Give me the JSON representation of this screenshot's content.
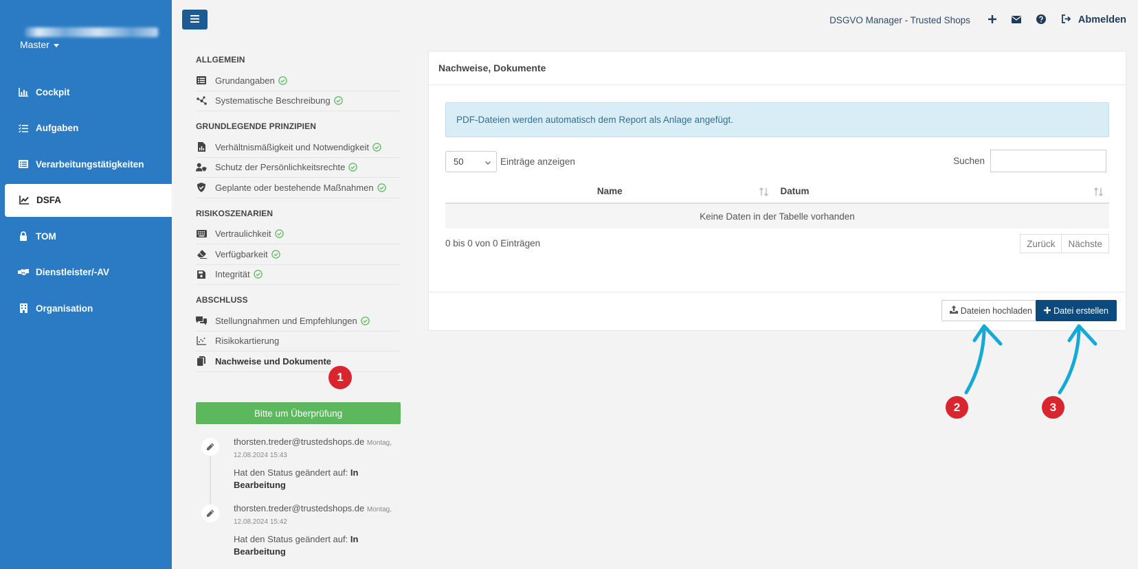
{
  "sidebar": {
    "user_email_blurred": "(blurred)",
    "workspace": "Master",
    "items": [
      {
        "label": "Cockpit",
        "icon": "chart-bar-icon"
      },
      {
        "label": "Aufgaben",
        "icon": "tasks-icon"
      },
      {
        "label": "Verarbeitungstätigkeiten",
        "icon": "list-icon"
      },
      {
        "label": "DSFA",
        "icon": "chart-line-icon",
        "active": true
      },
      {
        "label": "TOM",
        "icon": "lock-icon"
      },
      {
        "label": "Dienstleister/-AV",
        "icon": "handshake-icon"
      },
      {
        "label": "Organisation",
        "icon": "building-icon"
      }
    ]
  },
  "header": {
    "brand": "DSGVO Manager - Trusted Shops",
    "logout_label": "Abmelden"
  },
  "menu": {
    "sections": [
      {
        "title": "ALLGEMEIN",
        "items": [
          {
            "label": "Grundangaben",
            "icon": "list-icon",
            "done": true
          },
          {
            "label": "Systematische Beschreibung",
            "icon": "network-icon",
            "done": true
          }
        ]
      },
      {
        "title": "GRUNDLEGENDE PRINZIPIEN",
        "items": [
          {
            "label": "Verhältnismäßigkeit und Notwendigkeit",
            "icon": "file-chart-icon",
            "done": true
          },
          {
            "label": "Schutz der Persönlichkeitsrechte",
            "icon": "user-shield-icon",
            "done": true
          },
          {
            "label": "Geplante oder bestehende Maßnahmen",
            "icon": "shield-check-icon",
            "done": true
          }
        ]
      },
      {
        "title": "RISIKOSZENARIEN",
        "items": [
          {
            "label": "Vertraulichkeit",
            "icon": "keyboard-icon",
            "done": true
          },
          {
            "label": "Verfügbarkeit",
            "icon": "eraser-icon",
            "done": true
          },
          {
            "label": "Integrität",
            "icon": "save-icon",
            "done": true
          }
        ]
      },
      {
        "title": "ABSCHLUSS",
        "items": [
          {
            "label": "Stellungnahmen und Empfehlungen",
            "icon": "comments-icon",
            "done": true
          },
          {
            "label": "Risikokartierung",
            "icon": "scatter-chart-icon",
            "done": false
          },
          {
            "label": "Nachweise und Dokumente",
            "icon": "copy-icon",
            "done": false,
            "active": true
          }
        ]
      }
    ],
    "review_button": "Bitte um Überprüfung"
  },
  "timeline": [
    {
      "user": "thorsten.treder@trustedshops.de",
      "date_line1": "Montag,",
      "date_line2": "12.08.2024 15:43",
      "text": "Hat den Status geändert auf:",
      "status": "In Bearbeitung"
    },
    {
      "user": "thorsten.treder@trustedshops.de",
      "date_line1": "Montag,",
      "date_line2": "12.08.2024 15:42",
      "text": "Hat den Status geändert auf:",
      "status": "In Bearbeitung"
    }
  ],
  "panel": {
    "title": "Nachweise, Dokumente",
    "alert": "PDF-Dateien werden automatisch dem Report als Anlage angefügt.",
    "length_value": "50",
    "length_label": "Einträge anzeigen",
    "search_label": "Suchen",
    "search_value": "",
    "columns": [
      "Name",
      "Datum"
    ],
    "empty_text": "Keine Daten in der Tabelle vorhanden",
    "info": "0 bis 0 von 0 Einträgen",
    "prev": "Zurück",
    "next": "Nächste",
    "upload_button": "Dateien hochladen",
    "create_button": "Datei erstellen"
  },
  "annotations": {
    "badge_1": "1",
    "badge_2": "2",
    "badge_3": "3",
    "color": "#d9262e",
    "arrow_color": "#15a9d6"
  }
}
